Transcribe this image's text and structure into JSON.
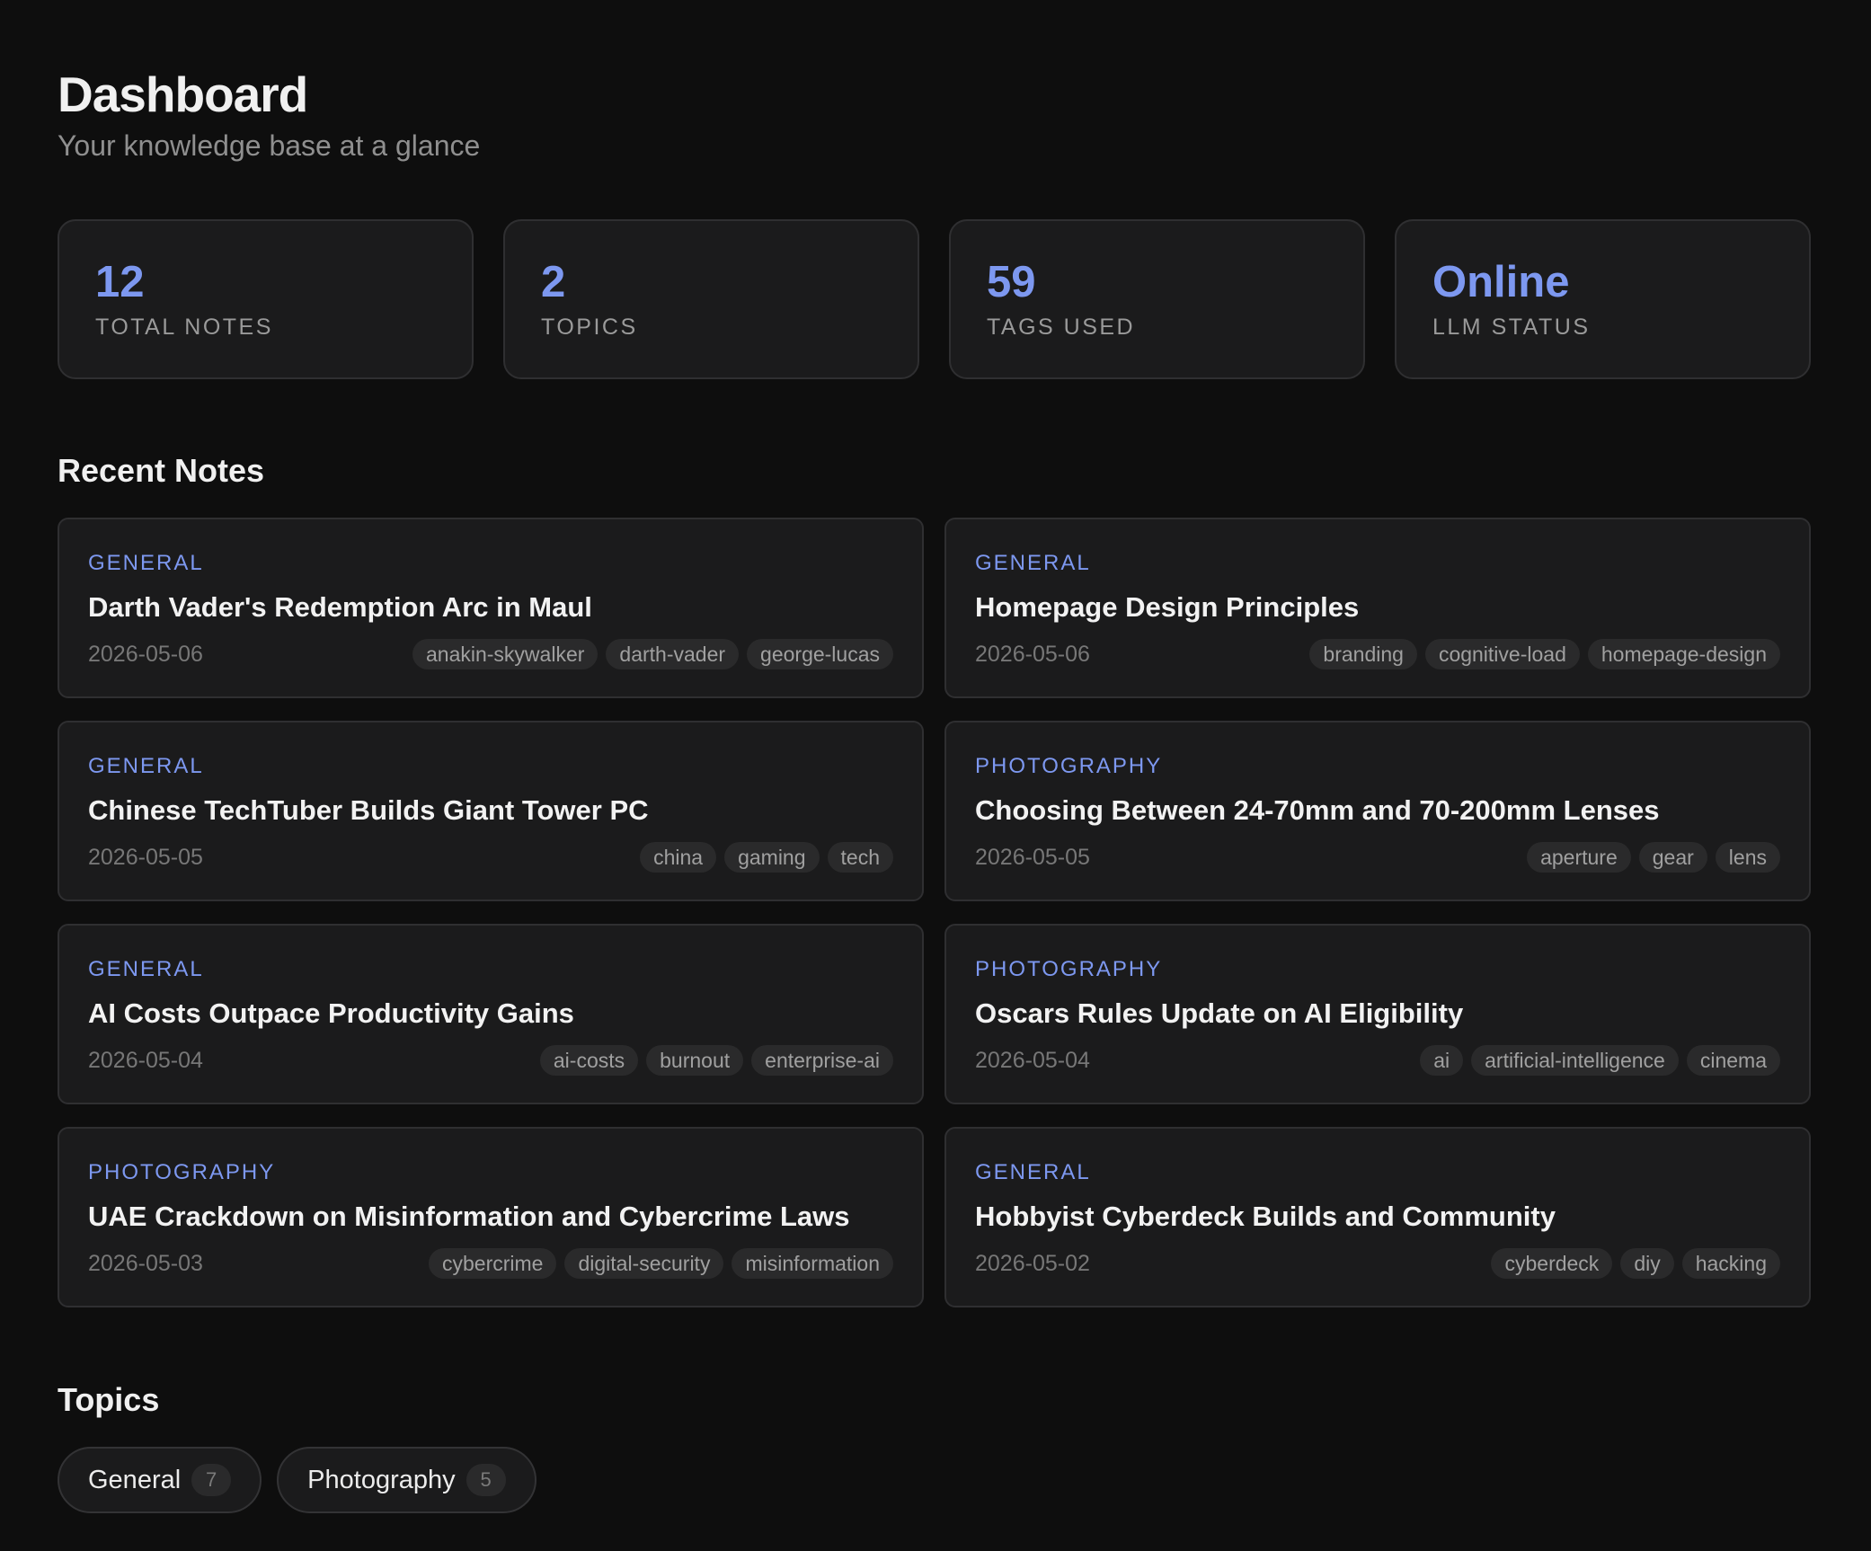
{
  "header": {
    "title": "Dashboard",
    "subtitle": "Your knowledge base at a glance"
  },
  "stats": [
    {
      "value": "12",
      "label": "TOTAL NOTES"
    },
    {
      "value": "2",
      "label": "TOPICS"
    },
    {
      "value": "59",
      "label": "TAGS USED"
    },
    {
      "value": "Online",
      "label": "LLM STATUS"
    }
  ],
  "recent": {
    "title": "Recent Notes",
    "notes": [
      {
        "topic": "GENERAL",
        "title": "Darth Vader's Redemption Arc in Maul",
        "date": "2026-05-06",
        "tags": [
          "anakin-skywalker",
          "darth-vader",
          "george-lucas"
        ]
      },
      {
        "topic": "GENERAL",
        "title": "Homepage Design Principles",
        "date": "2026-05-06",
        "tags": [
          "branding",
          "cognitive-load",
          "homepage-design"
        ]
      },
      {
        "topic": "GENERAL",
        "title": "Chinese TechTuber Builds Giant Tower PC",
        "date": "2026-05-05",
        "tags": [
          "china",
          "gaming",
          "tech"
        ]
      },
      {
        "topic": "PHOTOGRAPHY",
        "title": "Choosing Between 24-70mm and 70-200mm Lenses",
        "date": "2026-05-05",
        "tags": [
          "aperture",
          "gear",
          "lens"
        ]
      },
      {
        "topic": "GENERAL",
        "title": "AI Costs Outpace Productivity Gains",
        "date": "2026-05-04",
        "tags": [
          "ai-costs",
          "burnout",
          "enterprise-ai"
        ]
      },
      {
        "topic": "PHOTOGRAPHY",
        "title": "Oscars Rules Update on AI Eligibility",
        "date": "2026-05-04",
        "tags": [
          "ai",
          "artificial-intelligence",
          "cinema"
        ]
      },
      {
        "topic": "PHOTOGRAPHY",
        "title": "UAE Crackdown on Misinformation and Cybercrime Laws",
        "date": "2026-05-03",
        "tags": [
          "cybercrime",
          "digital-security",
          "misinformation"
        ]
      },
      {
        "topic": "GENERAL",
        "title": "Hobbyist Cyberdeck Builds and Community",
        "date": "2026-05-02",
        "tags": [
          "cyberdeck",
          "diy",
          "hacking"
        ]
      }
    ]
  },
  "topics": {
    "title": "Topics",
    "items": [
      {
        "name": "General",
        "count": "7"
      },
      {
        "name": "Photography",
        "count": "5"
      }
    ]
  },
  "colors": {
    "background": "#0e0e0e",
    "card": "#1b1b1c",
    "accent": "#7d98f0",
    "border": "#2f2f31"
  }
}
